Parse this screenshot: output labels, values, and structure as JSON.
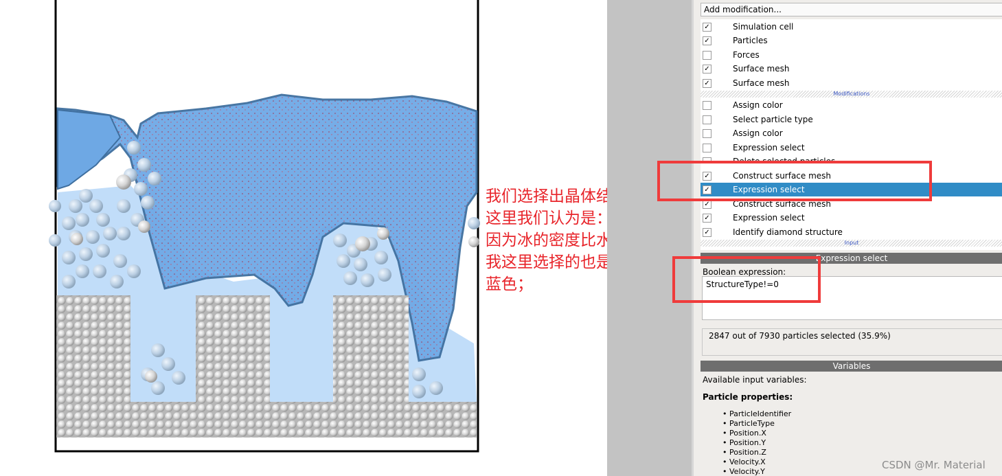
{
  "annotation": {
    "text": "我们选择出晶体结构\n这里我们认为是：冰\n因为冰的密度比水大\n我这里选择的也是深\n蓝色；"
  },
  "panel": {
    "add_modification": "Add modification...",
    "pipeline_items": [
      {
        "label": "Simulation cell",
        "checked": true
      },
      {
        "label": "Particles",
        "checked": true
      },
      {
        "label": "Forces",
        "checked": false
      },
      {
        "label": "Surface mesh",
        "checked": true
      },
      {
        "label": "Surface mesh",
        "checked": true
      }
    ],
    "modifications_section": "Modifications",
    "modifications": [
      {
        "label": "Assign color",
        "checked": false
      },
      {
        "label": "Select particle type",
        "checked": false
      },
      {
        "label": "Assign color",
        "checked": false
      },
      {
        "label": "Expression select",
        "checked": false
      },
      {
        "label": "Delete selected particles",
        "checked": false
      },
      {
        "label": "Construct surface mesh",
        "checked": true
      },
      {
        "label": "Expression select",
        "checked": true,
        "selected": true
      },
      {
        "label": "Construct surface mesh",
        "checked": true
      },
      {
        "label": "Expression select",
        "checked": true
      },
      {
        "label": "Identify diamond structure",
        "checked": true
      }
    ],
    "input_section": "Input",
    "expression_select_header": "Expression select",
    "boolean_label": "Boolean expression:",
    "boolean_value": "StructureType!=0",
    "status": "2847 out of 7930 particles selected (35.9%)",
    "variables_header": "Variables",
    "available_label": "Available input variables:",
    "particle_properties_label": "Particle properties:",
    "variables": [
      "ParticleIdentifier",
      "ParticleType",
      "Position.X",
      "Position.Y",
      "Position.Z",
      "Velocity.X",
      "Velocity.Y"
    ]
  },
  "watermark": "CSDN @Mr. Material",
  "colors": {
    "accent_selected": "#308cc6",
    "annotation_red": "#e8252b",
    "water_blue": "#7fb6ee",
    "ice_blue": "#b9d8f8"
  }
}
